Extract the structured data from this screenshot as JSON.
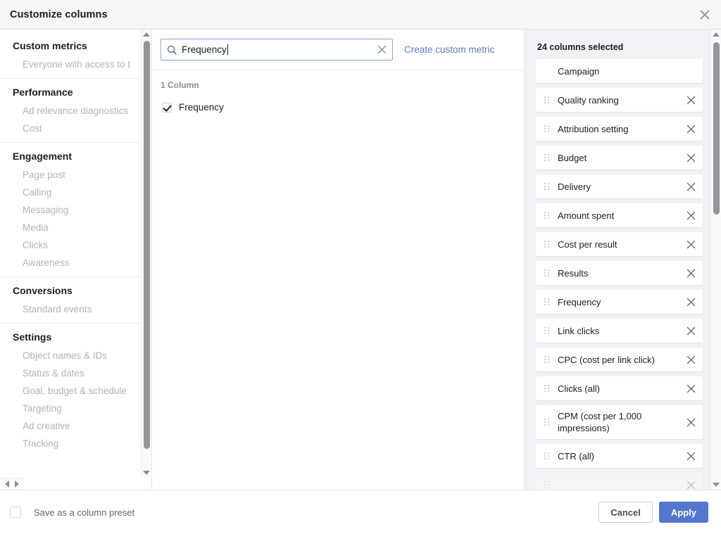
{
  "header": {
    "title": "Customize columns",
    "close_icon": "close-icon"
  },
  "sidebar": {
    "groups": [
      {
        "heading": "Custom metrics",
        "items": [
          "Everyone with access to t"
        ]
      },
      {
        "heading": "Performance",
        "items": [
          "Ad relevance diagnostics",
          "Cost"
        ]
      },
      {
        "heading": "Engagement",
        "items": [
          "Page post",
          "Calling",
          "Messaging",
          "Media",
          "Clicks",
          "Awareness"
        ]
      },
      {
        "heading": "Conversions",
        "items": [
          "Standard events"
        ]
      },
      {
        "heading": "Settings",
        "items": [
          "Object names & IDs",
          "Status & dates",
          "Goal, budget & schedule",
          "Targeting",
          "Ad creative",
          "Tracking"
        ]
      }
    ]
  },
  "search": {
    "value": "Frequency",
    "placeholder": "Search",
    "search_icon": "search-icon",
    "clear_icon": "clear-icon",
    "create_link": "Create custom metric"
  },
  "results": {
    "count_label": "1 Column",
    "items": [
      {
        "label": "Frequency",
        "checked": true
      }
    ]
  },
  "selected": {
    "count_label": "24 columns selected",
    "items": [
      {
        "label": "Campaign",
        "draggable": false,
        "removable": false
      },
      {
        "label": "Quality ranking",
        "draggable": true,
        "removable": true
      },
      {
        "label": "Attribution setting",
        "draggable": true,
        "removable": true
      },
      {
        "label": "Budget",
        "draggable": true,
        "removable": true
      },
      {
        "label": "Delivery",
        "draggable": true,
        "removable": true
      },
      {
        "label": "Amount spent",
        "draggable": true,
        "removable": true
      },
      {
        "label": "Cost per result",
        "draggable": true,
        "removable": true
      },
      {
        "label": "Results",
        "draggable": true,
        "removable": true
      },
      {
        "label": "Frequency",
        "draggable": true,
        "removable": true
      },
      {
        "label": "Link clicks",
        "draggable": true,
        "removable": true
      },
      {
        "label": "CPC (cost per link click)",
        "draggable": true,
        "removable": true
      },
      {
        "label": "Clicks (all)",
        "draggable": true,
        "removable": true
      },
      {
        "label": "CPM (cost per 1,000 impressions)",
        "draggable": true,
        "removable": true
      },
      {
        "label": "CTR (all)",
        "draggable": true,
        "removable": true
      },
      {
        "label": "",
        "draggable": true,
        "removable": true
      }
    ]
  },
  "footer": {
    "preset_label": "Save as a column preset",
    "preset_checked": false,
    "cancel_label": "Cancel",
    "apply_label": "Apply"
  },
  "colors": {
    "accent": "#5576cd",
    "link": "#5d7bc4",
    "header_bg": "#f5f6f7",
    "right_bg": "#f0f2f5",
    "text": "#1c1e21",
    "muted": "#b0b3b8"
  }
}
